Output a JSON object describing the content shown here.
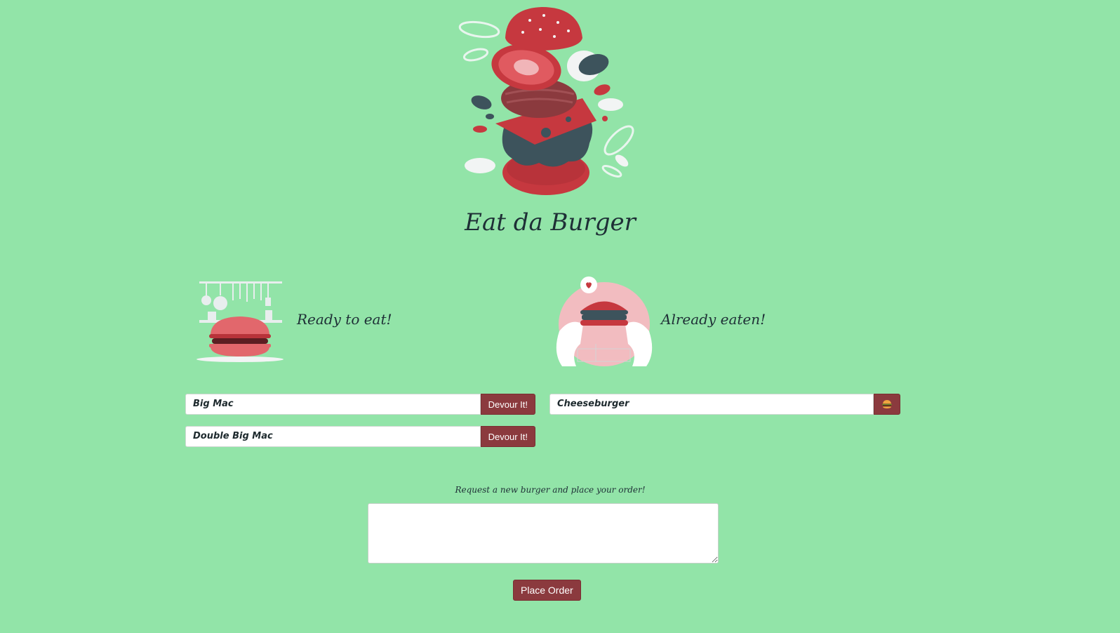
{
  "header": {
    "title": "Eat da Burger"
  },
  "ready": {
    "label": "Ready to eat!",
    "burgers": [
      {
        "name": "Big Mac",
        "action": "Devour It!"
      },
      {
        "name": "Double Big Mac",
        "action": "Devour It!"
      }
    ]
  },
  "eaten": {
    "label": "Already eaten!",
    "burgers": [
      {
        "name": "Cheeseburger",
        "icon": "burger-icon"
      }
    ]
  },
  "order": {
    "prompt": "Request a new burger and place your order!",
    "value": "",
    "placeholder": "",
    "submit_label": "Place Order"
  },
  "colors": {
    "background": "#92e4a8",
    "button": "#8b3a3e",
    "bun": "#c6383f",
    "dark": "#3d535c"
  }
}
